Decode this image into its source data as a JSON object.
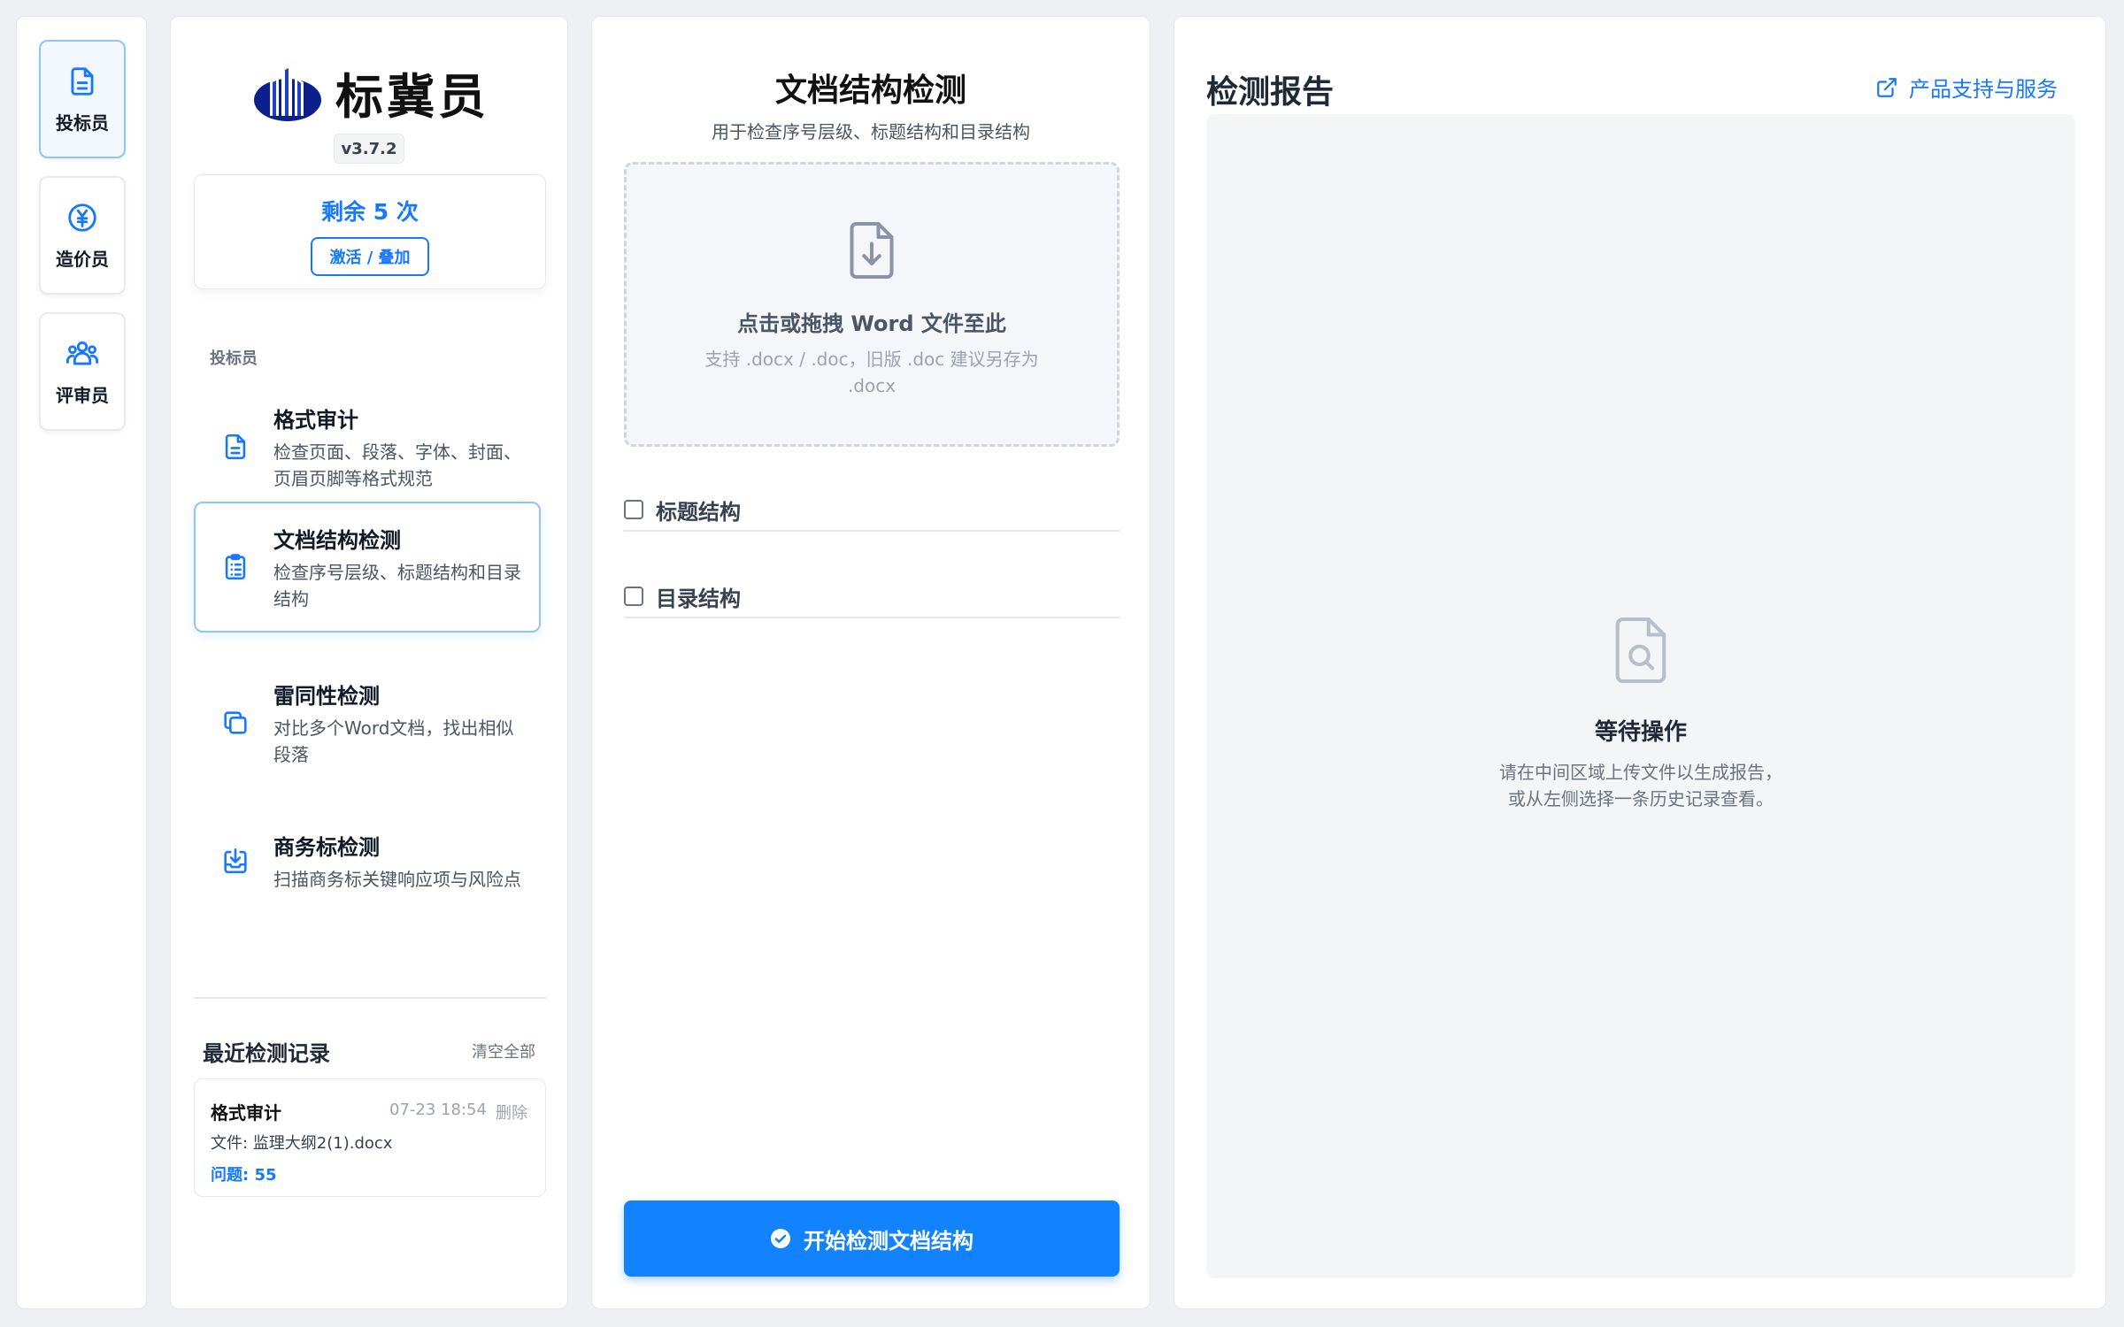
{
  "rail": {
    "items": [
      {
        "label": "投标员",
        "icon": "document-icon",
        "active": true
      },
      {
        "label": "造价员",
        "icon": "yen-icon",
        "active": false
      },
      {
        "label": "评审员",
        "icon": "team-icon",
        "active": false
      }
    ]
  },
  "nav": {
    "logo_text": "标冀员",
    "version": "v3.7.2",
    "quota_text": "剩余 5 次",
    "quota_button": "激活 / 叠加",
    "section_label": "投标员",
    "tools": [
      {
        "title": "格式审计",
        "desc": "检查页面、段落、字体、封面、页眉页脚等格式规范",
        "icon": "document-icon"
      },
      {
        "title": "文档结构检测",
        "desc": "检查序号层级、标题结构和目录结构",
        "icon": "clipboard-icon",
        "active": true
      },
      {
        "title": "雷同性检测",
        "desc": "对比多个Word文档，找出相似段落",
        "icon": "copy-icon"
      },
      {
        "title": "商务标检测",
        "desc": "扫描商务标关键响应项与风险点",
        "icon": "inbox-download-icon"
      }
    ],
    "recent_title": "最近检测记录",
    "clear_all": "清空全部",
    "records": [
      {
        "title": "格式审计",
        "time": "07-23 18:54",
        "delete": "删除",
        "file": "文件: 监理大纲2(1).docx",
        "issues": "问题: 55"
      }
    ]
  },
  "center": {
    "title": "文档结构检测",
    "subtitle": "用于检查序号层级、标题结构和目录结构",
    "dropzone_main": "点击或拖拽 Word 文件至此",
    "dropzone_sub": "支持 .docx / .doc，旧版 .doc 建议另存为 .docx",
    "options": [
      {
        "label": "标题结构",
        "checked": false
      },
      {
        "label": "目录结构",
        "checked": false
      }
    ],
    "start_button": "开始检测文档结构"
  },
  "report": {
    "title": "检测报告",
    "support_link": "产品支持与服务",
    "empty_title": "等待操作",
    "empty_desc_1": "请在中间区域上传文件以生成报告，",
    "empty_desc_2": "或从左侧选择一条历史记录查看。"
  },
  "colors": {
    "accent": "#1677ff",
    "button": "#1282ff",
    "active_border": "#8ec5ff"
  }
}
